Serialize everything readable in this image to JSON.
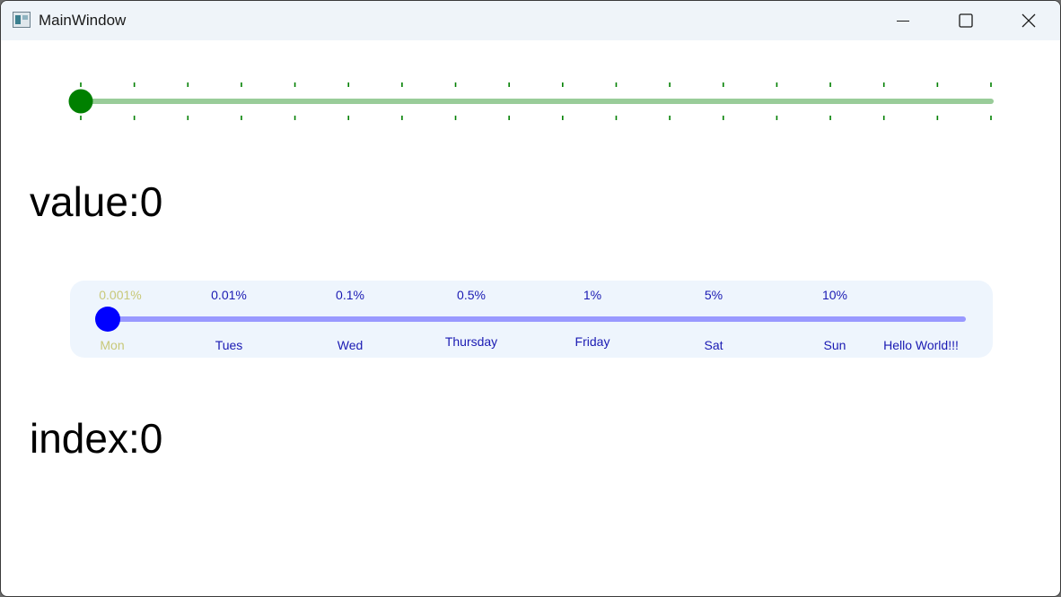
{
  "window": {
    "title": "MainWindow",
    "controls": {
      "minimize": "minimize-icon",
      "maximize": "maximize-icon",
      "close": "close-icon"
    }
  },
  "value_slider": {
    "value": 0,
    "min": 0,
    "max": 17,
    "tick_count": 18,
    "colors": {
      "track": "#99cc99",
      "handle": "#008000",
      "ticks": "#008000"
    }
  },
  "value_label": "value:0",
  "index_slider": {
    "selected_index": 0,
    "top_labels": [
      "0.001%",
      "0.01%",
      "0.1%",
      "0.5%",
      "1%",
      "5%",
      "10%"
    ],
    "bottom_labels": [
      "Mon",
      "Tues",
      "Wed",
      "Thursday",
      "Friday",
      "Sat",
      "Sun",
      "Hello World!!!"
    ],
    "colors": {
      "panel": "#eef5fd",
      "track": "#9999ff",
      "handle": "#0000ff",
      "label": "#1a1ab3",
      "active_label": "#c8c878"
    }
  },
  "index_label": "index:0"
}
